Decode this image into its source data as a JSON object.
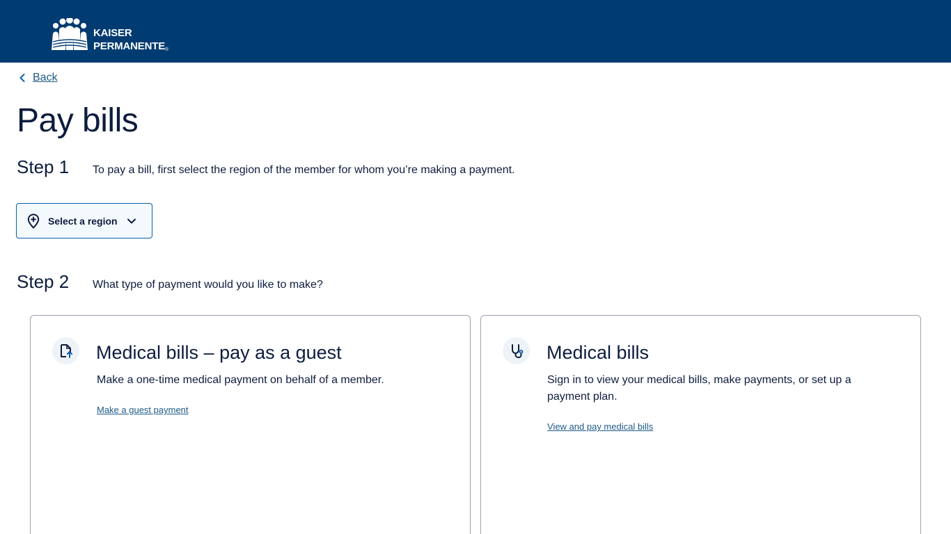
{
  "header": {
    "brand_line1": "KAISER",
    "brand_line2": "PERMANENTE",
    "brand_mark": "®",
    "background": "#003b71"
  },
  "nav": {
    "back_label": "Back",
    "back_icon": "chevron-left-icon"
  },
  "page": {
    "title": "Pay bills"
  },
  "step1": {
    "label": "Step 1",
    "text": "To pay a bill, first select the region of the member for whom you’re making a payment.",
    "region_button_label": "Select a region",
    "region_icon": "map-pin-plus-icon",
    "dropdown_icon": "chevron-down-icon"
  },
  "step2": {
    "label": "Step 2",
    "text": "What type of payment would you like to make?"
  },
  "cards": [
    {
      "title": "Medical bills – pay as a guest",
      "description": "Make a one-time medical payment on behalf of a member.",
      "link": "Make a guest payment",
      "icon": "document-payment-icon"
    },
    {
      "title": "Medical bills",
      "description": "Sign in to view your medical bills, make payments, or set up a payment plan.",
      "link": "View and pay medical bills",
      "icon": "stethoscope-icon"
    }
  ],
  "colors": {
    "accent": "#0b5eab",
    "text": "#0d1c3d",
    "link": "#1d5a86"
  }
}
